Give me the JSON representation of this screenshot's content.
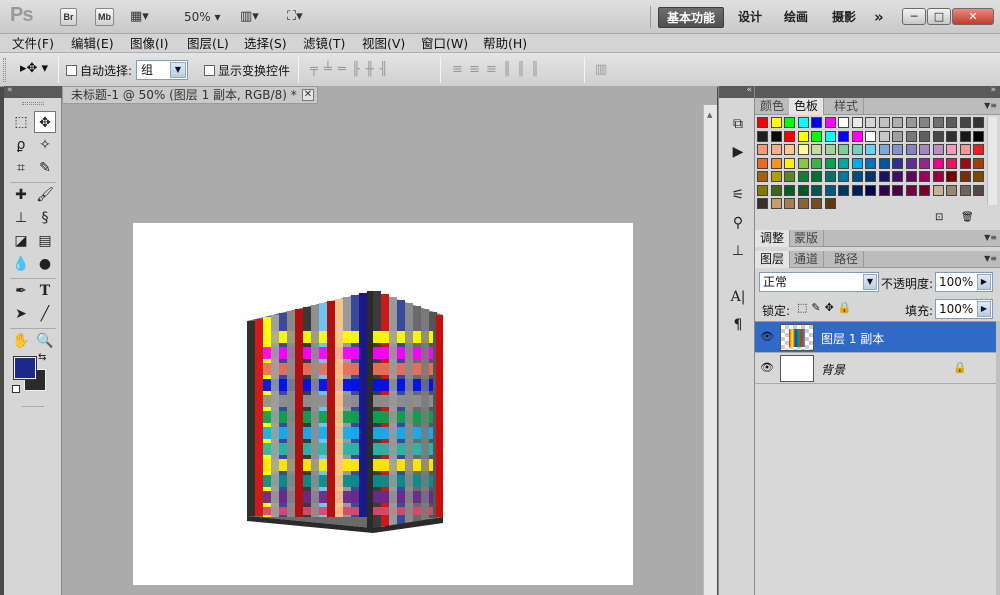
{
  "app": {
    "logo": "Ps",
    "bridge_label": "Br",
    "minibridge_label": "Mb",
    "zoom": "50%",
    "workspaces": [
      "基本功能",
      "设计",
      "绘画",
      "摄影"
    ],
    "workspace_more": "»",
    "window_buttons": [
      "─",
      "□",
      "✕"
    ]
  },
  "menu": [
    "文件(F)",
    "编辑(E)",
    "图像(I)",
    "图层(L)",
    "选择(S)",
    "滤镜(T)",
    "视图(V)",
    "窗口(W)",
    "帮助(H)"
  ],
  "options": {
    "auto_select_label": "自动选择:",
    "auto_select_value": "组",
    "show_transform_label": "显示变换控件"
  },
  "document": {
    "tab_title": "未标题-1 @ 50% (图层 1 副本, RGB/8) *",
    "close": "✕"
  },
  "swatches_panel": {
    "tabs": [
      "颜色",
      "色板",
      "样式"
    ],
    "active_tab": "色板",
    "colors": [
      "#ff0000",
      "#ffff00",
      "#00ff00",
      "#00ffff",
      "#0000ff",
      "#ff00ff",
      "#ffffff",
      "#ebebeb",
      "#d6d6d6",
      "#c2c2c2",
      "#adadad",
      "#999999",
      "#858585",
      "#707070",
      "#5c5c5c",
      "#474747",
      "#333333",
      "#1f1f1f",
      "#0a0a0a",
      "#ff0000",
      "#ffff00",
      "#00ff00",
      "#00ffff",
      "#0000ff",
      "#ff00ff",
      "#ffffff",
      "#c8c8c8",
      "#a0a0a0",
      "#787878",
      "#606060",
      "#484848",
      "#303030",
      "#181818",
      "#000000",
      "#f7977a",
      "#f9ad81",
      "#fdc68a",
      "#fff79a",
      "#c4df9b",
      "#a2d39c",
      "#82ca9d",
      "#7bcdc8",
      "#6ecff6",
      "#7ea7d8",
      "#8493ca",
      "#8882be",
      "#a187be",
      "#bc8dbf",
      "#f49ac2",
      "#f6989d",
      "#ed1c24",
      "#f26522",
      "#f7941d",
      "#fff200",
      "#8dc63f",
      "#39b54a",
      "#00a651",
      "#00a99d",
      "#00aeef",
      "#0072bc",
      "#0054a6",
      "#2e3192",
      "#662d91",
      "#92278f",
      "#ec008c",
      "#ed145b",
      "#9e0b0f",
      "#a0410d",
      "#a3620a",
      "#aba000",
      "#598527",
      "#1a7b30",
      "#007236",
      "#00746b",
      "#0076a3",
      "#004b80",
      "#003471",
      "#1b1464",
      "#440e62",
      "#630460",
      "#9e005d",
      "#9e0039",
      "#790000",
      "#7b2e00",
      "#7d4900",
      "#827b00",
      "#406618",
      "#005e20",
      "#005826",
      "#005952",
      "#005b7f",
      "#003663",
      "#002157",
      "#0d004c",
      "#32004b",
      "#4b0049",
      "#7b0046",
      "#7a0026",
      "#c7b299",
      "#998675",
      "#736357",
      "#534741",
      "#37302a",
      "#c69c6d",
      "#a67c52",
      "#8c6239",
      "#754c24",
      "#603913"
    ]
  },
  "adjustments_panel": {
    "tabs": [
      "调整",
      "蒙版"
    ],
    "active_tab": "调整"
  },
  "layers_panel": {
    "tabs": [
      "图层",
      "通道",
      "路径"
    ],
    "active_tab": "图层",
    "blend_mode": "正常",
    "opacity_label": "不透明度:",
    "opacity": "100%",
    "lock_label": "锁定:",
    "fill_label": "填充:",
    "fill": "100%",
    "layers": [
      {
        "name": "图层 1 副本",
        "selected": true
      },
      {
        "name": "背景",
        "selected": false,
        "locked": true
      }
    ]
  },
  "colors": {
    "foreground": "#1d2a8c",
    "background": "#2b2b2b",
    "selection": "#3169c6"
  }
}
